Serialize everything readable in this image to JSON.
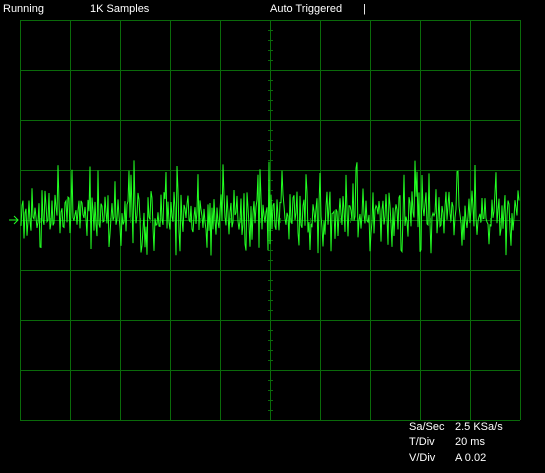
{
  "status": {
    "run_state": "Running",
    "samples": "1K Samples",
    "trigger": "Auto Triggered",
    "cursor_mark": "|"
  },
  "readouts": {
    "sample_rate_label": "Sa/Sec",
    "sample_rate_value": "2.5 KSa/s",
    "time_div_label": "T/Div",
    "time_div_value": "20 ms",
    "volt_div_label": "V/Div",
    "volt_div_value": "A 0.02"
  },
  "display": {
    "grid_color": "#0a6a0a",
    "trace_color": "#22ff22",
    "ground_marker_color": "#22ff22",
    "background": "#000000"
  }
}
